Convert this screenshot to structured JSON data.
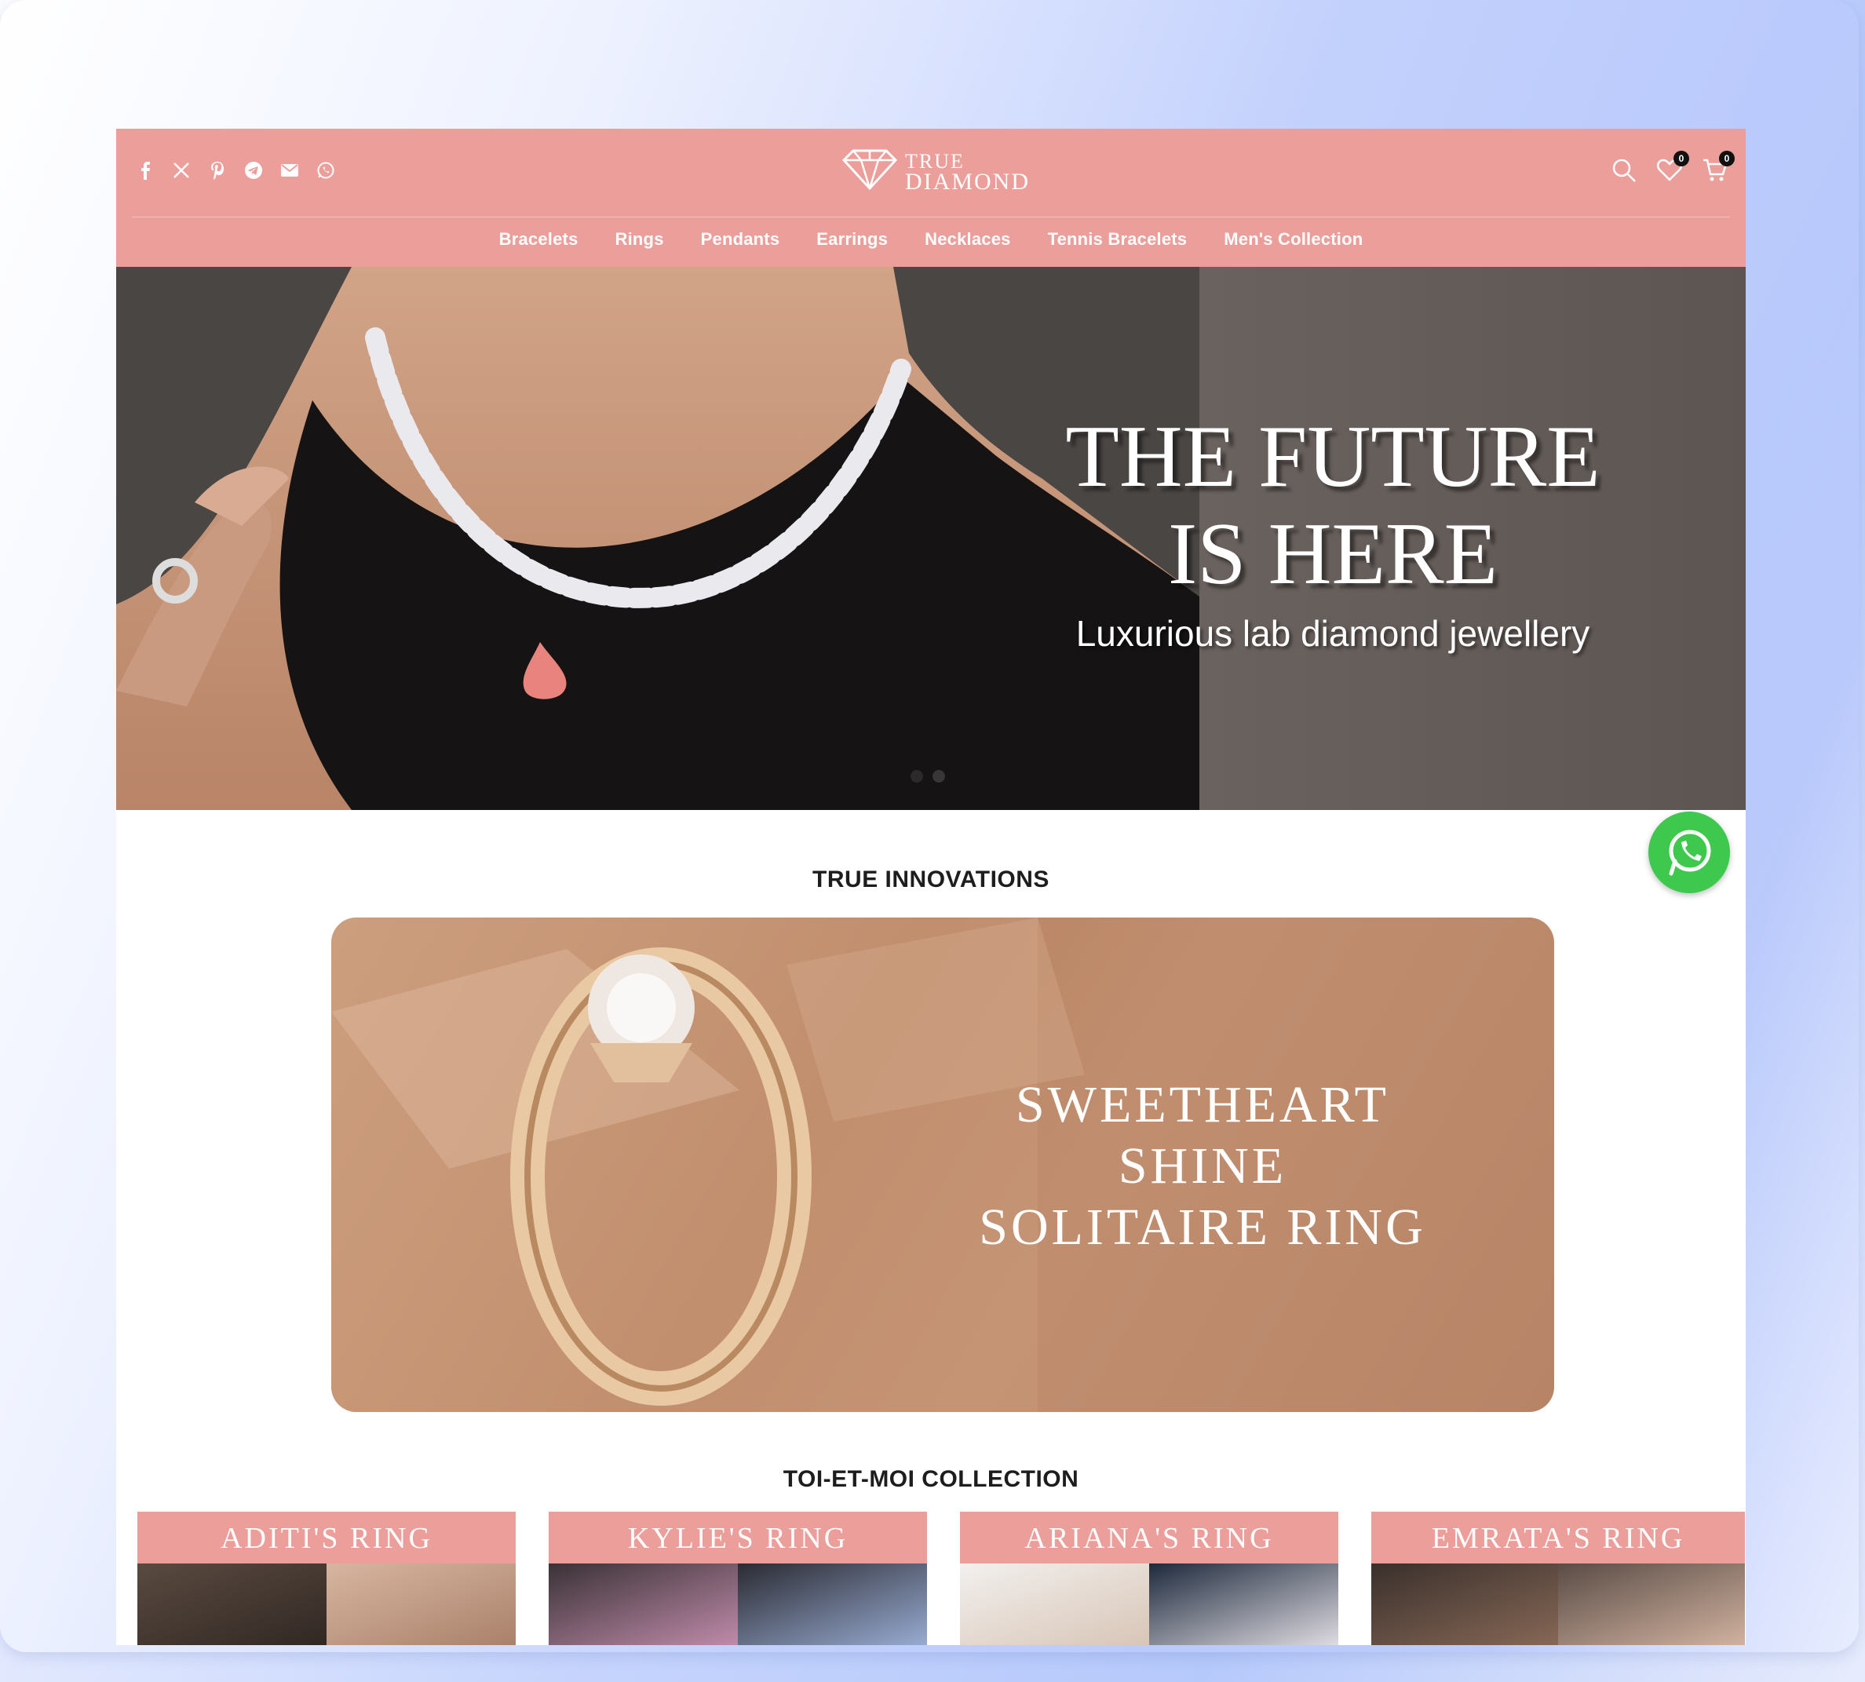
{
  "social": [
    "facebook-icon",
    "x-icon",
    "pinterest-icon",
    "telegram-icon",
    "mail-icon",
    "whatsapp-icon"
  ],
  "logo": {
    "line1": "TRUE",
    "line2": "DIAMOND"
  },
  "header": {
    "wishlist_count": "0",
    "cart_count": "0"
  },
  "nav": [
    "Bracelets",
    "Rings",
    "Pendants",
    "Earrings",
    "Necklaces",
    "Tennis Bracelets",
    "Men's Collection"
  ],
  "hero": {
    "title_line1": "THE FUTURE",
    "title_line2": "IS HERE",
    "subtitle": "Luxurious lab diamond jewellery"
  },
  "innovations": {
    "title": "TRUE INNOVATIONS",
    "banner_line1": "SWEETHEART",
    "banner_line2": "SHINE",
    "banner_line3": "SOLITAIRE RING"
  },
  "collection": {
    "title": "TOI-ET-MOI COLLECTION",
    "cards": [
      "ADITI'S  RING",
      "KYLIE'S  RING",
      "ARIANA'S  RING",
      "EMRATA'S  RING"
    ]
  },
  "colors": {
    "brand_pink": "#ec9e9a",
    "whatsapp_green": "#3ec94e"
  }
}
